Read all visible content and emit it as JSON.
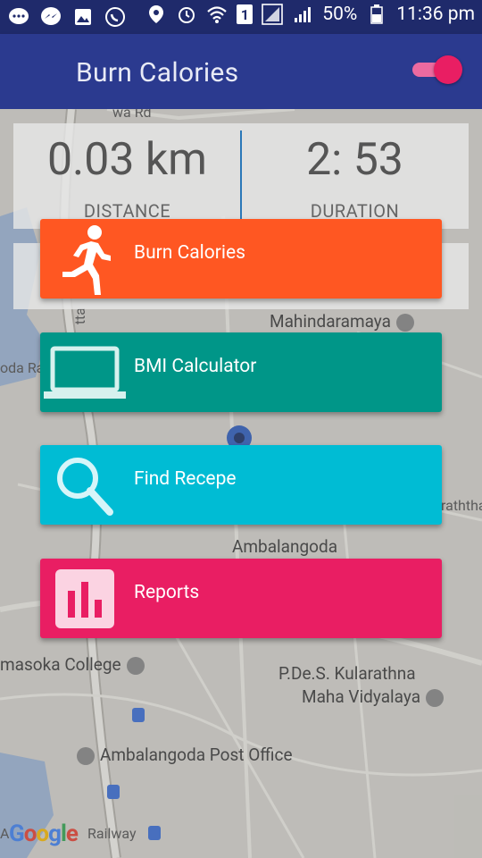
{
  "status_bar": {
    "battery": "50%",
    "time": "11:36 pm",
    "sim_slot": "1"
  },
  "app_bar": {
    "title": "Burn Calories",
    "toggle_on": true
  },
  "stats": {
    "distance_value": "0.03 km",
    "distance_label": "DISTANCE",
    "duration_value": "2: 53",
    "duration_label": "DURATION"
  },
  "menu": {
    "items": [
      {
        "label": "Burn Calories",
        "icon": "running-person-icon",
        "color": "#FF5722"
      },
      {
        "label": "BMI Calculator",
        "icon": "laptop-icon",
        "color": "#009688"
      },
      {
        "label": "Find Recepe",
        "icon": "search-icon",
        "color": "#00BCD4"
      },
      {
        "label": "Reports",
        "icon": "bar-chart-icon",
        "color": "#E91E63"
      }
    ]
  },
  "map": {
    "labels": {
      "road_top": "wa Rd",
      "mahindaramaya": "Mahindaramaya",
      "oda_ra": "oda Ra",
      "ambalangoda": "Ambalangoda",
      "raththa": "raththa",
      "masoka_college": "masoka College",
      "pdes_line1": "P.De.S. Kularathna",
      "pdes_line2": "Maha Vidyalaya",
      "post_office": "Ambalangoda Post Office",
      "railway": "Railway",
      "left_a": "A",
      "vertical_tta": "tta"
    },
    "google_logo": "Google"
  }
}
